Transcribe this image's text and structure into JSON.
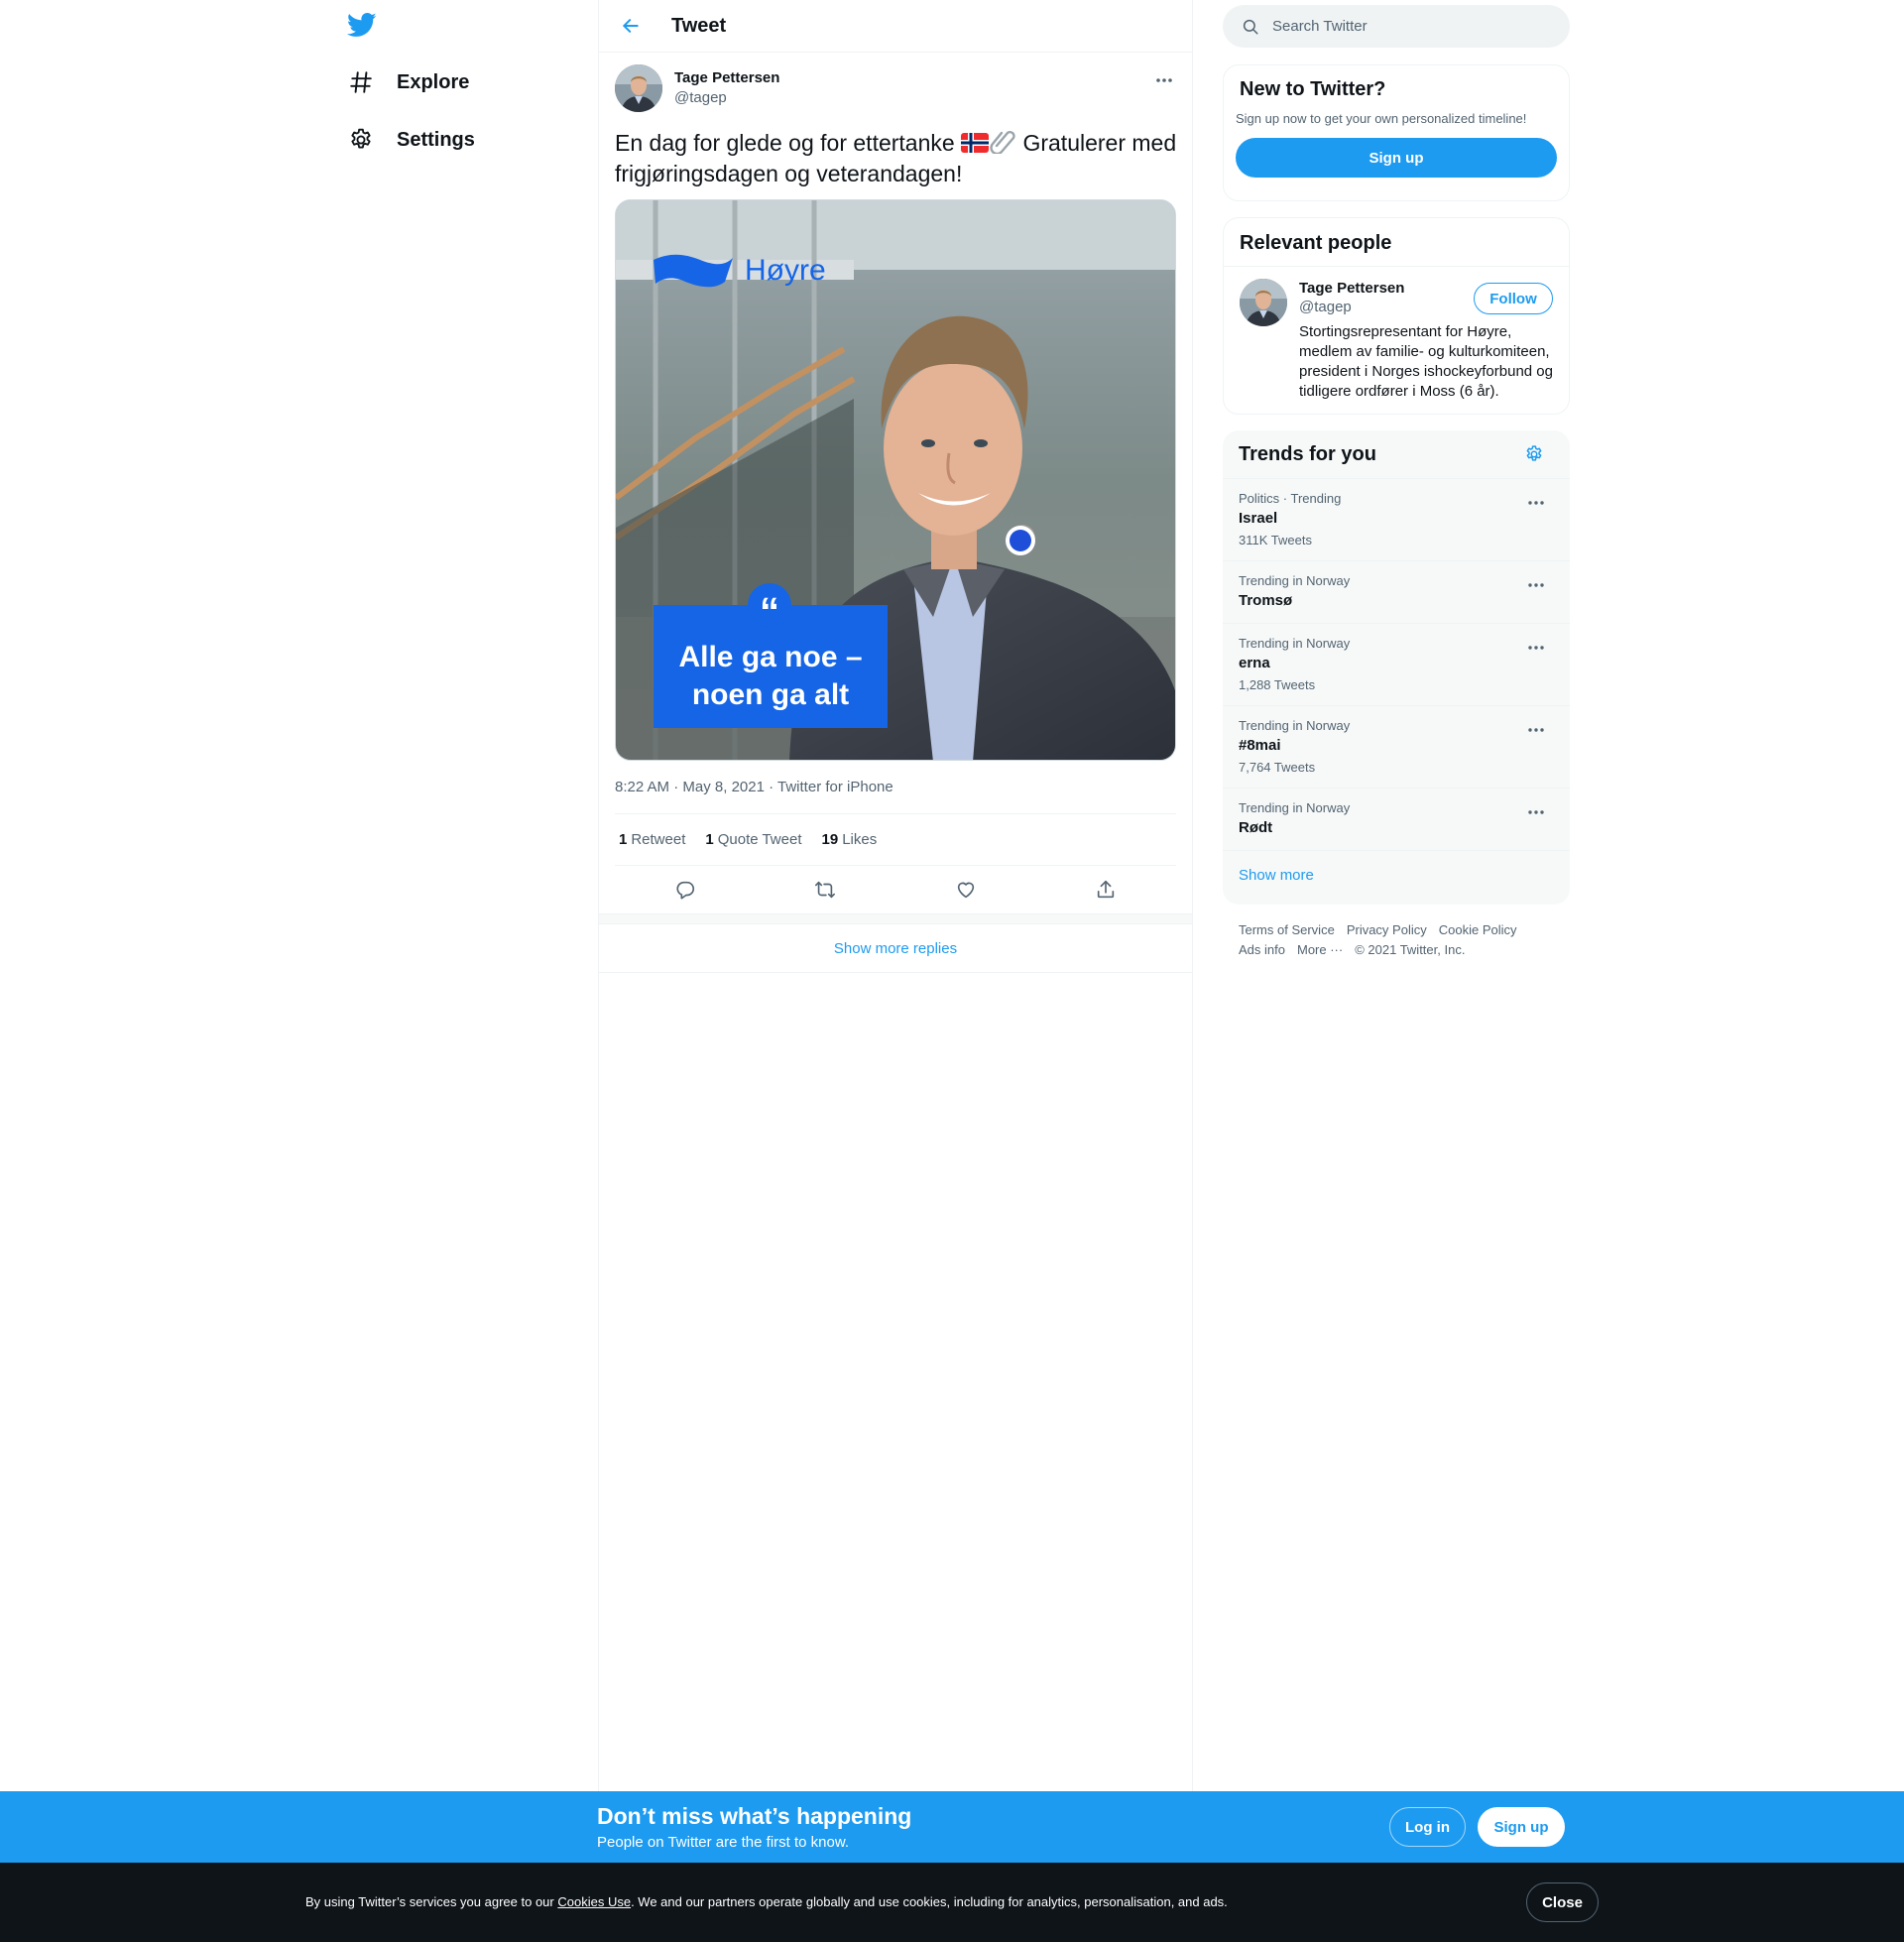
{
  "nav": {
    "logo": "twitter-bird-icon",
    "items": [
      {
        "label": "Explore",
        "icon": "hashtag-icon"
      },
      {
        "label": "Settings",
        "icon": "gear-icon"
      }
    ]
  },
  "header": {
    "title": "Tweet",
    "back_icon": "arrow-left-icon"
  },
  "tweet": {
    "author_name": "Tage Pettersen",
    "author_handle": "@tagep",
    "text_before_emoji": "En dag for glede og for ettertanke ",
    "text_after_emoji": " Gratulerer med frigjøringsdagen og veterandagen!",
    "emojis": [
      "norway-flag",
      "paperclip"
    ],
    "image": {
      "brand_text": "Høyre",
      "quote_mark": "“",
      "quote_line1": "Alle ga noe –",
      "quote_line2": "noen ga alt"
    },
    "time": "8:22 AM",
    "date": "May 8, 2021",
    "source": "Twitter for iPhone",
    "sep": " · ",
    "stats": [
      {
        "count": "1",
        "label": "Retweet"
      },
      {
        "count": "1",
        "label": "Quote Tweet"
      },
      {
        "count": "19",
        "label": "Likes"
      }
    ],
    "actions": [
      "reply-icon",
      "retweet-icon",
      "like-icon",
      "share-icon"
    ],
    "show_more_replies": "Show more replies"
  },
  "search": {
    "placeholder": "Search Twitter"
  },
  "new_to_twitter": {
    "title": "New to Twitter?",
    "subtitle": "Sign up now to get your own personalized timeline!",
    "button": "Sign up"
  },
  "relevant_people": {
    "title": "Relevant people",
    "name": "Tage Pettersen",
    "handle": "@tagep",
    "follow": "Follow",
    "bio": "Stortingsrepresentant for Høyre, medlem av familie- og kulturkomiteen, president i Norges ishockeyforbund og tidligere ordfører i Moss (6 år)."
  },
  "trends": {
    "title": "Trends for you",
    "items": [
      {
        "context": "Politics · Trending",
        "name": "Israel",
        "count": "311K Tweets"
      },
      {
        "context": "Trending in Norway",
        "name": "Tromsø",
        "count": ""
      },
      {
        "context": "Trending in Norway",
        "name": "erna",
        "count": "1,288 Tweets"
      },
      {
        "context": "Trending in Norway",
        "name": "#8mai",
        "count": "7,764 Tweets"
      },
      {
        "context": "Trending in Norway",
        "name": "Rødt",
        "count": ""
      }
    ],
    "show_more": "Show more"
  },
  "footer": {
    "links": [
      "Terms of Service",
      "Privacy Policy",
      "Cookie Policy",
      "Ads info",
      "More ···",
      "© 2021 Twitter, Inc."
    ]
  },
  "signup_bar": {
    "title": "Don’t miss what’s happening",
    "subtitle": "People on Twitter are the first to know.",
    "login": "Log in",
    "signup": "Sign up"
  },
  "cookie_bar": {
    "text_before": "By using Twitter’s services you agree to our ",
    "link": "Cookies Use",
    "text_after": ". We and our partners operate globally and use cookies, including for analytics, personalisation, and ads.",
    "close": "Close"
  },
  "colors": {
    "accent": "#1d9bf0",
    "hoyre_blue": "#1565e6",
    "text": "#0f1419",
    "muted": "#536471"
  }
}
